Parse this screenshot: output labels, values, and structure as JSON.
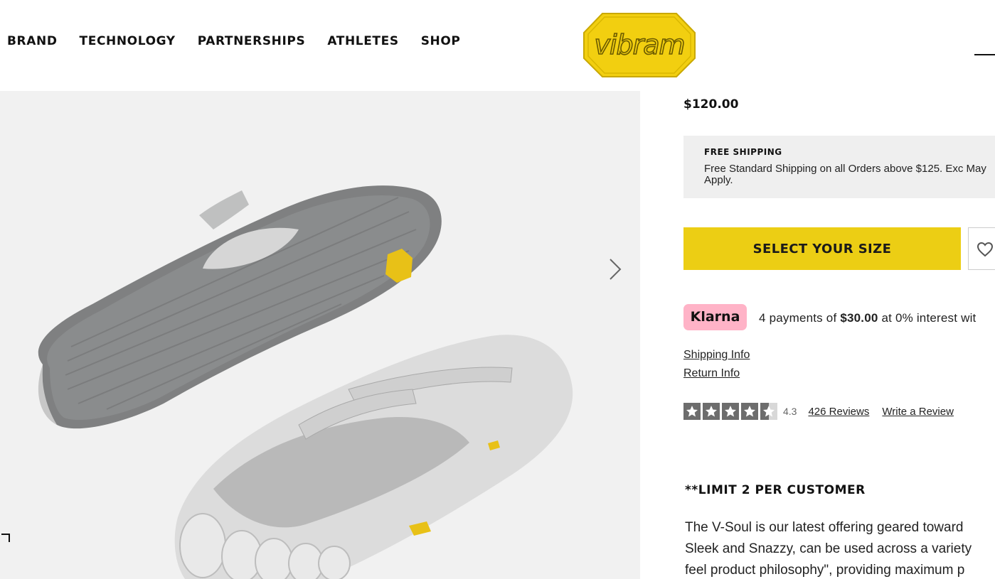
{
  "nav": {
    "items": [
      "BRAND",
      "TECHNOLOGY",
      "PARTNERSHIPS",
      "ATHLETES",
      "SHOP"
    ]
  },
  "logo": {
    "text": "vibram",
    "color": "#f2cf10"
  },
  "product": {
    "price": "$120.00",
    "shipping": {
      "title": "FREE SHIPPING",
      "text": "Free Standard Shipping on all Orders above $125. Exc May Apply."
    },
    "select_size_label": "SELECT YOUR SIZE",
    "klarna": {
      "badge": "Klarna",
      "prefix": "4 payments of ",
      "amount": "$30.00",
      "suffix": " at 0% interest wit"
    },
    "links": {
      "shipping": "Shipping Info",
      "returns": "Return Info"
    },
    "rating": {
      "value": "4.3",
      "stars": 4.3,
      "reviews": "426 Reviews",
      "write": "Write a Review"
    },
    "limit": "**LIMIT 2 PER CUSTOMER",
    "description": [
      "The V-Soul is our latest offering geared toward",
      "Sleek and Snazzy, can be used across a variety",
      "feel product philosophy\", providing maximum p"
    ]
  },
  "colors": {
    "accent": "#ecce14",
    "klarna_pink": "#ffb3c7",
    "gallery_bg": "#f1f1f1",
    "shipping_bg": "#efefef"
  }
}
